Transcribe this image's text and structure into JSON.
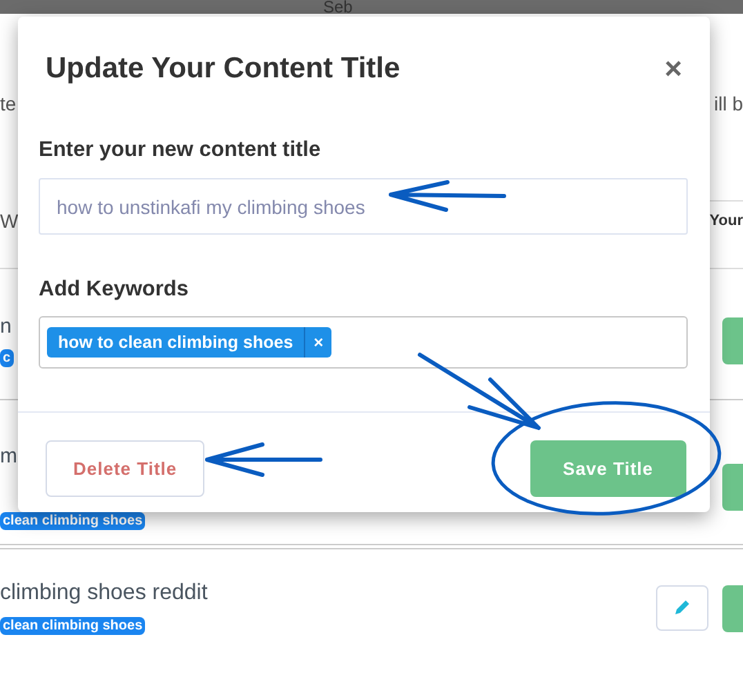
{
  "top_bar": {
    "user": "Seb"
  },
  "page": {
    "intro_left": "te",
    "intro_right": "ill b",
    "filter_left": "W",
    "filter_right": "Your",
    "rows": [
      {
        "title": "n",
        "keyword": "c",
        "edit_button": false
      },
      {
        "title": "m",
        "keyword": "clean climbing shoes",
        "edit_button": false
      },
      {
        "title": "climbing shoes reddit",
        "keyword": "clean climbing shoes",
        "edit_button": true
      }
    ]
  },
  "dialog": {
    "title": "Update Your Content Title",
    "close": "×",
    "title_label": "Enter your new content title",
    "title_value": "how to unstinkafi my climbing shoes",
    "keywords_label": "Add Keywords",
    "keywords": [
      {
        "text": "how to clean climbing shoes",
        "remove": "×"
      }
    ],
    "buttons": [
      {
        "kind": "delete",
        "label": "Delete Title"
      },
      {
        "kind": "save",
        "label": "Save Title"
      }
    ]
  }
}
